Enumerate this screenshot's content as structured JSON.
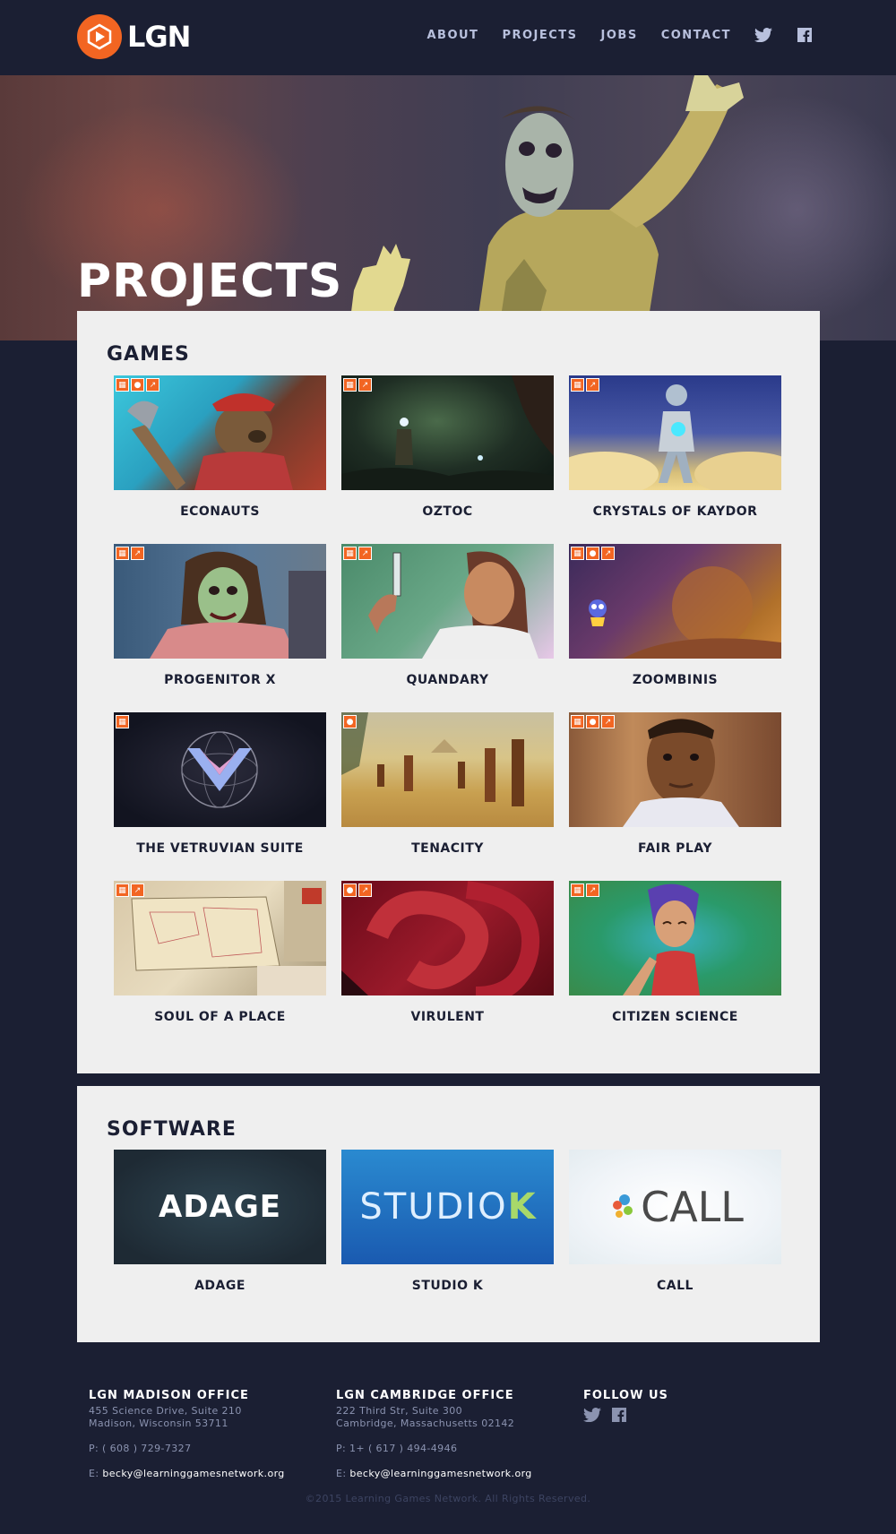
{
  "header": {
    "logo_text": "LGN",
    "nav": [
      "ABOUT",
      "PROJECTS",
      "JOBS",
      "CONTACT"
    ],
    "social_icons": [
      "twitter-icon",
      "facebook-icon"
    ]
  },
  "hero": {
    "title": "PROJECTS"
  },
  "games": {
    "title": "GAMES",
    "items": [
      {
        "name": "ECONAUTS",
        "platforms": [
          "windows",
          "apple",
          "web"
        ]
      },
      {
        "name": "OZTOC",
        "platforms": [
          "windows",
          "web"
        ]
      },
      {
        "name": "CRYSTALS OF KAYDOR",
        "platforms": [
          "windows",
          "web"
        ]
      },
      {
        "name": "PROGENITOR X",
        "platforms": [
          "windows",
          "web"
        ]
      },
      {
        "name": "QUANDARY",
        "platforms": [
          "windows",
          "web"
        ]
      },
      {
        "name": "ZOOMBINIS",
        "platforms": [
          "windows",
          "apple",
          "web"
        ]
      },
      {
        "name": "THE VETRUVIAN SUITE",
        "platforms": [
          "windows"
        ]
      },
      {
        "name": "TENACITY",
        "platforms": [
          "apple"
        ]
      },
      {
        "name": "FAIR PLAY",
        "platforms": [
          "windows",
          "apple",
          "web"
        ]
      },
      {
        "name": "SOUL OF A PLACE",
        "platforms": [
          "windows",
          "web"
        ]
      },
      {
        "name": "VIRULENT",
        "platforms": [
          "apple",
          "web"
        ]
      },
      {
        "name": "CITIZEN SCIENCE",
        "platforms": [
          "windows",
          "web"
        ]
      }
    ]
  },
  "software": {
    "title": "SOFTWARE",
    "items": [
      {
        "name": "ADAGE",
        "logo": "ADAGE"
      },
      {
        "name": "STUDIO K",
        "logo_main": "STUDIO",
        "logo_accent": "K"
      },
      {
        "name": "CALL",
        "logo": "CALL"
      }
    ]
  },
  "footer": {
    "madison": {
      "title": "LGN MADISON OFFICE",
      "address1": "455 Science Drive, Suite 210",
      "address2": "Madison, Wisconsin 53711",
      "phone": "P: ( 608 ) 729-7327",
      "email_label": "E:",
      "email": "becky@learninggamesnetwork.org"
    },
    "cambridge": {
      "title": "LGN CAMBRIDGE OFFICE",
      "address1": "222 Third Str, Suite 300",
      "address2": "Cambridge, Massachusetts 02142",
      "phone": "P: 1+ ( 617 ) 494-4946",
      "email_label": "E:",
      "email": "becky@learninggamesnetwork.org"
    },
    "follow": {
      "title": "FOLLOW US"
    },
    "copyright": "©2015 Learning Games Network. All Rights Reserved."
  },
  "colors": {
    "accent": "#f26522",
    "background": "#1b1f33",
    "panel": "#efefef"
  }
}
